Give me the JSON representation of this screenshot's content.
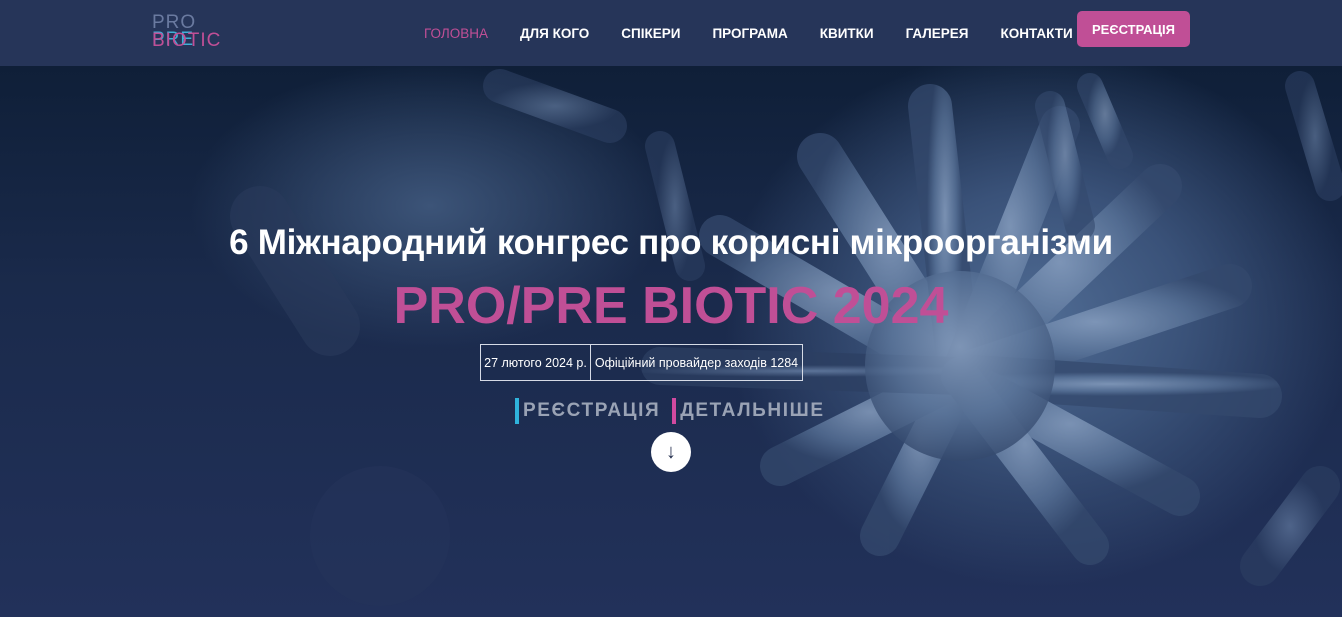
{
  "logo": {
    "pro": "PRO",
    "pre": "PRE",
    "biotic": "BIOTIC"
  },
  "nav": {
    "items": [
      {
        "label": "ГОЛОВНА",
        "active": true
      },
      {
        "label": "ДЛЯ КОГО",
        "active": false
      },
      {
        "label": "СПІКЕРИ",
        "active": false
      },
      {
        "label": "ПРОГРАМА",
        "active": false
      },
      {
        "label": "КВИТКИ",
        "active": false
      },
      {
        "label": "ГАЛЕРЕЯ",
        "active": false
      },
      {
        "label": "КОНТАКТИ",
        "active": false
      }
    ],
    "register_label": "РЕЄСТРАЦІЯ"
  },
  "hero": {
    "title": "6 Міжнародний конгрес про корисні мікроорганізми",
    "brand": "PRO/PRE BIOTIC 2024",
    "date": "27 лютого 2024 р.",
    "provider": "Офіційний провайдер заходів 1284",
    "cta_register": "РЕЄСТРАЦІЯ",
    "cta_more": "ДЕТАЛЬНІШЕ",
    "scroll_icon": "arrow-down-icon"
  },
  "colors": {
    "accent": "#c04f96",
    "accent_blue": "#2fb3dc",
    "nav_bg": "#263559",
    "hero_bg": "#1a2a4b"
  }
}
